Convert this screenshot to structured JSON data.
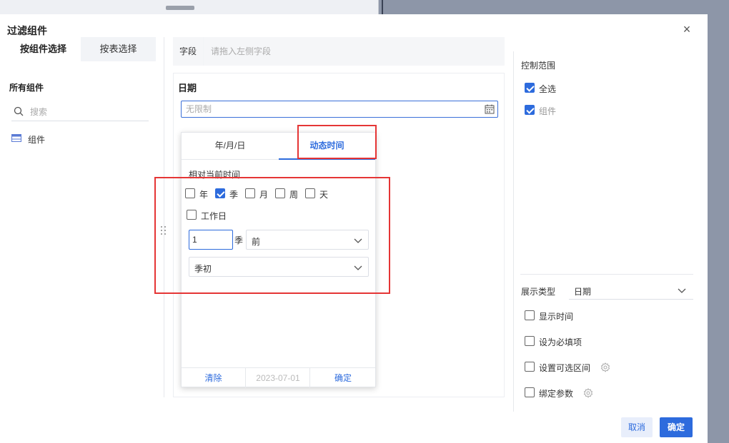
{
  "dialog": {
    "title": "过滤组件",
    "close_label": "×"
  },
  "left": {
    "tabs": [
      {
        "label": "按组件选择",
        "active": true
      },
      {
        "label": "按表选择",
        "active": false
      }
    ],
    "all_components_title": "所有组件",
    "search_placeholder": "搜索",
    "component_item": "组件"
  },
  "middle": {
    "field_label": "字段",
    "field_placeholder": "请拖入左侧字段",
    "date_title": "日期",
    "date_input_placeholder": "无限制"
  },
  "popup": {
    "tabs": [
      {
        "label": "年/月/日",
        "active": false
      },
      {
        "label": "动态时间",
        "active": true
      }
    ],
    "relative_label": "相对当前时间",
    "units": [
      {
        "label": "年",
        "checked": false
      },
      {
        "label": "季",
        "checked": true
      },
      {
        "label": "月",
        "checked": false
      },
      {
        "label": "周",
        "checked": false
      },
      {
        "label": "天",
        "checked": false
      }
    ],
    "workday": {
      "label": "工作日",
      "checked": false
    },
    "offset_value": "1",
    "offset_unit": "季",
    "direction": "前",
    "position": "季初",
    "footer": {
      "clear": "清除",
      "date": "2023-07-01",
      "ok": "确定"
    }
  },
  "right": {
    "control_scope_title": "控制范围",
    "select_all": {
      "label": "全选",
      "checked": true
    },
    "component": {
      "label": "组件",
      "checked": true
    },
    "display_type_label": "展示类型",
    "display_type_value": "日期",
    "options": [
      {
        "label": "显示时间",
        "checked": false,
        "gear": false
      },
      {
        "label": "设为必填项",
        "checked": false,
        "gear": false
      },
      {
        "label": "设置可选区间",
        "checked": false,
        "gear": true
      },
      {
        "label": "绑定参数",
        "checked": false,
        "gear": true
      }
    ]
  },
  "footer": {
    "cancel": "取消",
    "ok": "确定"
  },
  "colors": {
    "accent": "#2d6bdd",
    "annotation": "#e53535"
  }
}
